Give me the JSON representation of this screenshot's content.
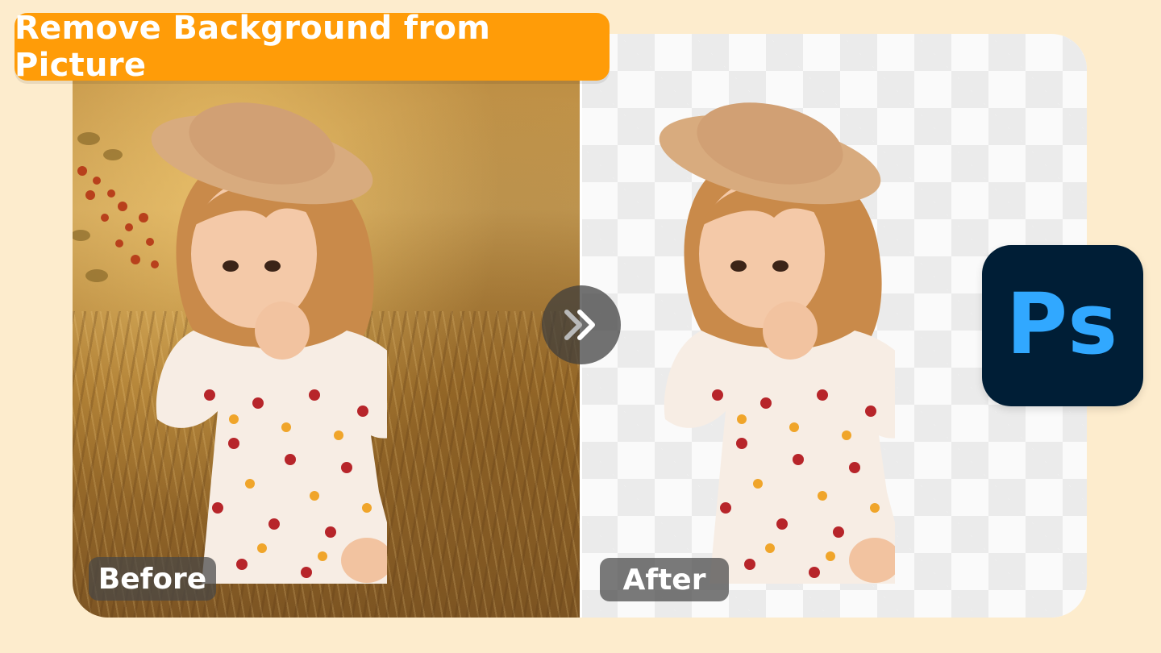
{
  "title": "Remove Background from Picture",
  "labels": {
    "before": "Before",
    "after": "After"
  },
  "logo": {
    "text": "Ps",
    "name": "adobe-photoshop-logo",
    "background": "#001e36",
    "color": "#31a8ff"
  },
  "colors": {
    "page_background": "#fdeccd",
    "title_badge": "#ff9c08",
    "checker_light": "#fafafa",
    "checker_dark": "#ebebeb"
  },
  "icons": {
    "compare_handle": "double-chevron-right-icon"
  }
}
